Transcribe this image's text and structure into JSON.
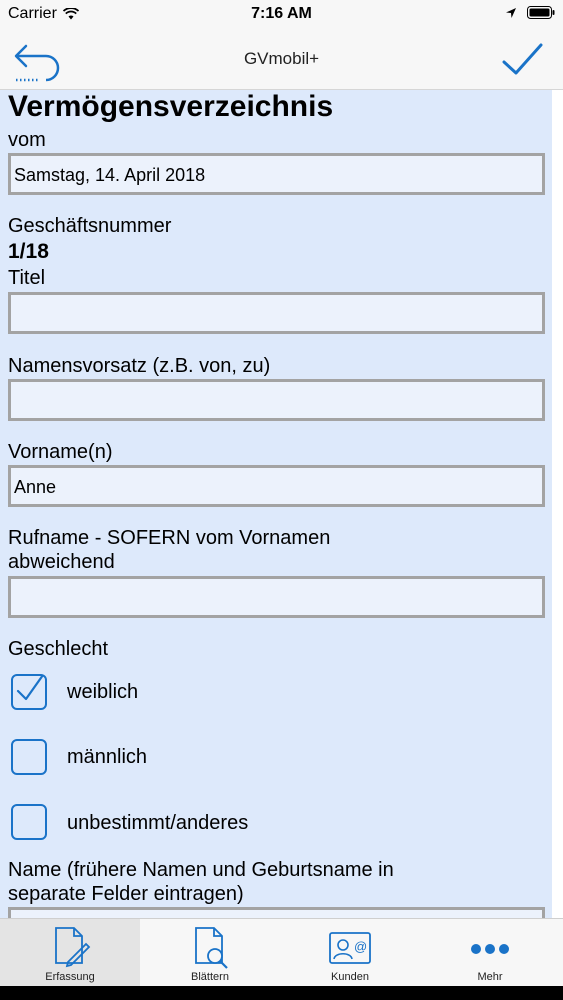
{
  "status_bar": {
    "carrier": "Carrier",
    "time": "7:16 AM"
  },
  "nav": {
    "title": "GVmobil+",
    "back_icon": "back-arrow-icon",
    "confirm_icon": "checkmark-icon"
  },
  "form": {
    "heading": "Vermögensverzeichnis",
    "vom_label": "vom",
    "vom_value": "Samstag, 14. April 2018",
    "geschaeftsnummer_label": "Geschäftsnummer",
    "geschaeftsnummer_value": "1/18",
    "titel_label": "Titel",
    "titel_value": "",
    "namensvorsatz_label": "Namensvorsatz (z.B. von, zu)",
    "namensvorsatz_value": "",
    "vorname_label": "Vorname(n)",
    "vorname_value": "Anne",
    "rufname_label_line1": "Rufname - SOFERN vom Vornamen",
    "rufname_label_line2": "abweichend",
    "rufname_value": "",
    "geschlecht_label": "Geschlecht",
    "geschlecht_options": [
      {
        "label": "weiblich",
        "checked": true
      },
      {
        "label": "männlich",
        "checked": false
      },
      {
        "label": "unbestimmt/anderes",
        "checked": false
      }
    ],
    "name_label_line1": "Name (frühere Namen und Geburtsname in",
    "name_label_line2": "separate Felder eintragen)"
  },
  "tabs": [
    {
      "label": "Erfassung",
      "icon": "document-edit-icon",
      "active": true
    },
    {
      "label": "Blättern",
      "icon": "document-search-icon",
      "active": false
    },
    {
      "label": "Kunden",
      "icon": "contact-card-icon",
      "active": false
    },
    {
      "label": "Mehr",
      "icon": "more-dots-icon",
      "active": false
    }
  ],
  "colors": {
    "accent": "#1a73c8",
    "form_background": "#dde9fb",
    "field_background": "#ecf2fc",
    "field_border": "#a3a3a3"
  }
}
